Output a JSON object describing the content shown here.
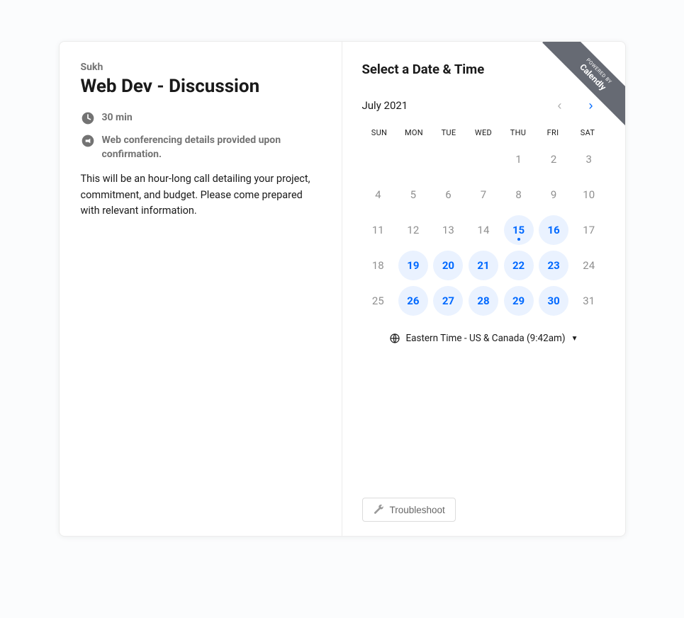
{
  "host": "Sukh",
  "title": "Web Dev - Discussion",
  "duration_label": "30 min",
  "conference_label": "Web conferencing details provided upon confirmation.",
  "description": "This will be an hour-long call detailing your project, commitment, and budget. Please come prepared with relevant information.",
  "right_title": "Select a Date & Time",
  "month_label": "July 2021",
  "dow": [
    "SUN",
    "MON",
    "TUE",
    "WED",
    "THU",
    "FRI",
    "SAT"
  ],
  "dates": [
    {
      "n": "",
      "state": "empty"
    },
    {
      "n": "",
      "state": "empty"
    },
    {
      "n": "",
      "state": "empty"
    },
    {
      "n": "",
      "state": "empty"
    },
    {
      "n": "1",
      "state": "disabled"
    },
    {
      "n": "2",
      "state": "disabled"
    },
    {
      "n": "3",
      "state": "disabled"
    },
    {
      "n": "4",
      "state": "disabled"
    },
    {
      "n": "5",
      "state": "disabled"
    },
    {
      "n": "6",
      "state": "disabled"
    },
    {
      "n": "7",
      "state": "disabled"
    },
    {
      "n": "8",
      "state": "disabled"
    },
    {
      "n": "9",
      "state": "disabled"
    },
    {
      "n": "10",
      "state": "disabled"
    },
    {
      "n": "11",
      "state": "disabled"
    },
    {
      "n": "12",
      "state": "disabled"
    },
    {
      "n": "13",
      "state": "disabled"
    },
    {
      "n": "14",
      "state": "disabled"
    },
    {
      "n": "15",
      "state": "available",
      "today": true
    },
    {
      "n": "16",
      "state": "available"
    },
    {
      "n": "17",
      "state": "disabled"
    },
    {
      "n": "18",
      "state": "disabled"
    },
    {
      "n": "19",
      "state": "available"
    },
    {
      "n": "20",
      "state": "available"
    },
    {
      "n": "21",
      "state": "available"
    },
    {
      "n": "22",
      "state": "available"
    },
    {
      "n": "23",
      "state": "available"
    },
    {
      "n": "24",
      "state": "disabled"
    },
    {
      "n": "25",
      "state": "disabled"
    },
    {
      "n": "26",
      "state": "available"
    },
    {
      "n": "27",
      "state": "available"
    },
    {
      "n": "28",
      "state": "available"
    },
    {
      "n": "29",
      "state": "available"
    },
    {
      "n": "30",
      "state": "available"
    },
    {
      "n": "31",
      "state": "disabled"
    }
  ],
  "timezone_label": "Eastern Time - US & Canada (9:42am)",
  "troubleshoot_label": "Troubleshoot",
  "ribbon": {
    "small": "POWERED BY",
    "big": "Calendly"
  }
}
